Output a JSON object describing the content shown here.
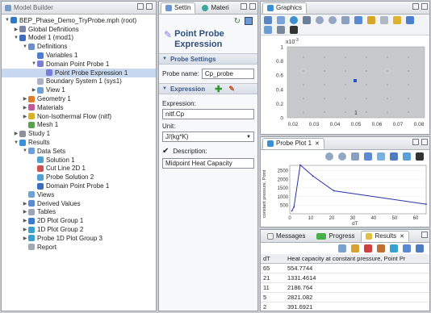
{
  "model_builder": {
    "title": "Model Builder",
    "items": [
      {
        "label": "BEP_Phase_Demo_TryProbe.mph (root)",
        "indent": 0,
        "tw": "▼",
        "color": "#2f78c8"
      },
      {
        "label": "Global Definitions",
        "indent": 1,
        "tw": "▶",
        "color": "#7a86a3"
      },
      {
        "label": "Model 1 (mod1)",
        "indent": 1,
        "tw": "▼",
        "color": "#3b6cc0"
      },
      {
        "label": "Definitions",
        "indent": 2,
        "tw": "▼",
        "color": "#6b8fc7"
      },
      {
        "label": "Variables 1",
        "indent": 3,
        "tw": "",
        "color": "#4a7fd0"
      },
      {
        "label": "Domain Point Probe 1",
        "indent": 3,
        "tw": "▼",
        "color": "#7a7dd8"
      },
      {
        "label": "Point Probe Expression 1",
        "indent": 4,
        "tw": "",
        "color": "#7a7dd8",
        "selected": true
      },
      {
        "label": "Boundary System 1 (sys1)",
        "indent": 3,
        "tw": "",
        "color": "#a7b2c2"
      },
      {
        "label": "View 1",
        "indent": 3,
        "tw": "▶",
        "color": "#6fa0d8"
      },
      {
        "label": "Geometry 1",
        "indent": 2,
        "tw": "▶",
        "color": "#e07b2c"
      },
      {
        "label": "Materials",
        "indent": 2,
        "tw": "▶",
        "color": "#c15a9a"
      },
      {
        "label": "Non-Isothermal Flow (nitf)",
        "indent": 2,
        "tw": "▶",
        "color": "#d9b12a"
      },
      {
        "label": "Mesh 1",
        "indent": 2,
        "tw": "",
        "color": "#5aa14e"
      },
      {
        "label": "Study 1",
        "indent": 1,
        "tw": "▶",
        "color": "#8a8f99"
      },
      {
        "label": "Results",
        "indent": 1,
        "tw": "▼",
        "color": "#3b8fd8"
      },
      {
        "label": "Data Sets",
        "indent": 2,
        "tw": "▼",
        "color": "#6d9fd8"
      },
      {
        "label": "Solution 1",
        "indent": 3,
        "tw": "",
        "color": "#4da0d0"
      },
      {
        "label": "Cut Line 2D 1",
        "indent": 3,
        "tw": "",
        "color": "#d05050"
      },
      {
        "label": "Probe Solution 2",
        "indent": 3,
        "tw": "",
        "color": "#4da0d0"
      },
      {
        "label": "Domain Point Probe 1",
        "indent": 3,
        "tw": "",
        "color": "#3a6ec0"
      },
      {
        "label": "Views",
        "indent": 2,
        "tw": "",
        "color": "#6fa0d8"
      },
      {
        "label": "Derived Values",
        "indent": 2,
        "tw": "▶",
        "color": "#5a8ad0"
      },
      {
        "label": "Tables",
        "indent": 2,
        "tw": "▶",
        "color": "#9aa5b5"
      },
      {
        "label": "2D Plot Group 1",
        "indent": 2,
        "tw": "▶",
        "color": "#3a7ad0"
      },
      {
        "label": "1D Plot Group 2",
        "indent": 2,
        "tw": "▶",
        "color": "#3aa0d0"
      },
      {
        "label": "Probe 1D Plot Group 3",
        "indent": 2,
        "tw": "▶",
        "color": "#3aa0d0"
      },
      {
        "label": "Report",
        "indent": 2,
        "tw": "",
        "color": "#a3a9b3"
      }
    ]
  },
  "settings": {
    "tabs": [
      "Settin",
      "Materi"
    ],
    "heading": "Point Probe Expression",
    "probe_settings_label": "Probe Settings",
    "probe_name_label": "Probe name:",
    "probe_name_value": "Cp_probe",
    "expression_section_label": "Expression",
    "expression_label": "Expression:",
    "expression_value": "nitf.Cp",
    "unit_label": "Unit:",
    "unit_value": "J/(kg*K)",
    "description_label": "Description:",
    "description_checked": true,
    "description_value": "Midpoint Heat Capacity"
  },
  "graphics": {
    "title": "Graphics",
    "scale_label": "x10",
    "scale_exp": "-3",
    "y_ticks": [
      "1",
      "0.8",
      "0.6",
      "0.4",
      "0.2",
      "0"
    ],
    "x_ticks": [
      "0.02",
      "0.03",
      "0.04",
      "0.05",
      "0.06",
      "0.07",
      "0.08"
    ],
    "domain_label": "1"
  },
  "probe_plot": {
    "title": "Probe Plot 1",
    "ylabel": "constant pressure, Point",
    "xlabel": "dT",
    "y_ticks": [
      "2500",
      "2000",
      "1500",
      "1000",
      "500"
    ],
    "x_ticks": [
      "0",
      "10",
      "20",
      "30",
      "40",
      "50",
      "60"
    ]
  },
  "chart_data": {
    "type": "line",
    "x": [
      1,
      2,
      5,
      11,
      21,
      65
    ],
    "series": [
      {
        "values": [
          167.0032,
          391.6921,
          2821.082,
          2186.764,
          1331.4614,
          554.7744
        ]
      }
    ],
    "xlabel": "dT",
    "ylabel": "constant pressure, Point",
    "xlim": [
      0,
      65
    ],
    "ylim": [
      0,
      2800
    ],
    "grid": true
  },
  "bottom_tabs": {
    "messages": "Messages",
    "progress": "Progress",
    "results": "Results"
  },
  "results_table": {
    "columns": [
      "dT",
      "Heat capacity at constant pressure, Point Pr"
    ],
    "rows": [
      [
        "65",
        "554.7744"
      ],
      [
        "21",
        "1331.4614"
      ],
      [
        "11",
        "2186.764"
      ],
      [
        "5",
        "2821.082"
      ],
      [
        "2",
        "391.6921"
      ],
      [
        "1",
        "167.0032"
      ]
    ]
  }
}
